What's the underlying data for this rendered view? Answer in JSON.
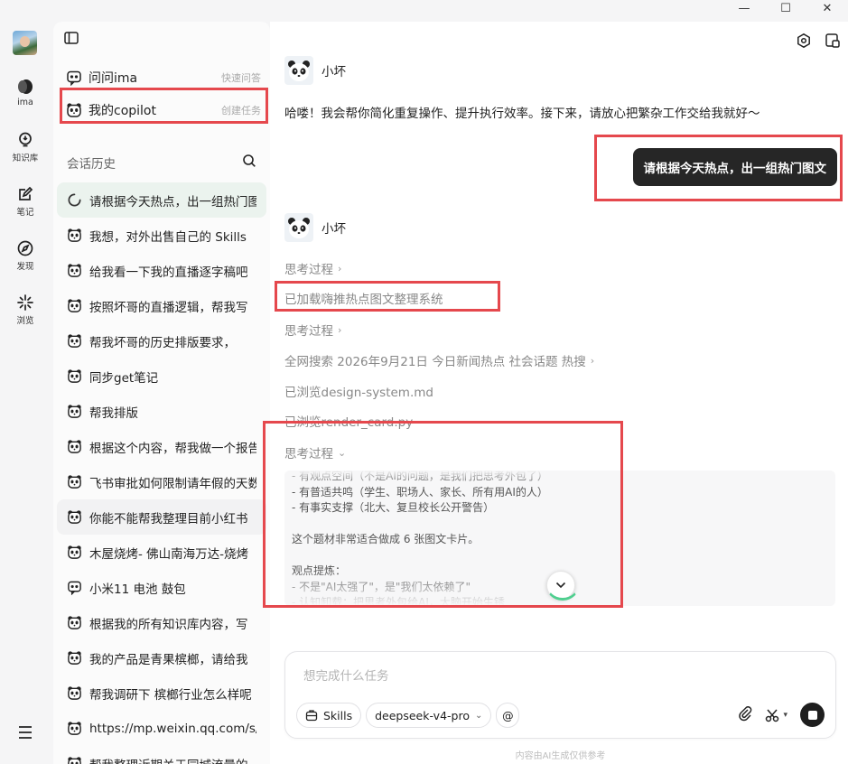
{
  "window": {
    "minimize": "—",
    "maximize": "☐",
    "close": "✕"
  },
  "rail": {
    "items": [
      {
        "label": "ima",
        "icon": "ima-logo-icon"
      },
      {
        "label": "知识库",
        "icon": "bulb-icon"
      },
      {
        "label": "笔记",
        "icon": "note-edit-icon"
      },
      {
        "label": "发现",
        "icon": "compass-icon"
      },
      {
        "label": "浏览",
        "icon": "sparkle-icon"
      }
    ]
  },
  "sidebar": {
    "quick": [
      {
        "label": "问问ima",
        "hint": "快速问答",
        "icon": "chat-bubble-icon"
      },
      {
        "label": "我的copilot",
        "hint": "创建任务",
        "icon": "panda-icon"
      }
    ],
    "history_title": "会话历史",
    "history": [
      {
        "text": "请根据今天热点，出一组热门图文",
        "icon": "loading-spinner-icon",
        "state": "active"
      },
      {
        "text": "我想，对外出售自己的 Skills",
        "icon": "panda-icon",
        "state": ""
      },
      {
        "text": "给我看一下我的直播逐字稿吧",
        "icon": "panda-icon",
        "state": ""
      },
      {
        "text": "按照坏哥的直播逻辑，帮我写",
        "icon": "panda-icon",
        "state": ""
      },
      {
        "text": "帮我坏哥的历史排版要求，",
        "icon": "panda-icon",
        "state": ""
      },
      {
        "text": "同步get笔记",
        "icon": "panda-icon",
        "state": ""
      },
      {
        "text": "帮我排版",
        "icon": "panda-icon",
        "state": ""
      },
      {
        "text": "根据这个内容，帮我做一个报告",
        "icon": "panda-icon",
        "state": ""
      },
      {
        "text": "飞书审批如何限制请年假的天数",
        "icon": "panda-icon",
        "state": ""
      },
      {
        "text": "你能不能帮我整理目前小红书",
        "icon": "panda-icon",
        "state": "hover"
      },
      {
        "text": "木屋烧烤- 佛山南海万达-烧烤",
        "icon": "panda-icon",
        "state": ""
      },
      {
        "text": "小米11 电池 鼓包",
        "icon": "chat-bubble-icon",
        "state": ""
      },
      {
        "text": "根据我的所有知识库内容，写",
        "icon": "panda-icon",
        "state": ""
      },
      {
        "text": "我的产品是青果槟榔，请给我",
        "icon": "panda-icon",
        "state": ""
      },
      {
        "text": "帮我调研下 槟榔行业怎么样呢",
        "icon": "panda-icon",
        "state": ""
      },
      {
        "text": "https://mp.weixin.qq.com/s/",
        "icon": "panda-icon",
        "state": ""
      },
      {
        "text": "帮我整理近期关于同城流量的",
        "icon": "panda-icon",
        "state": ""
      }
    ]
  },
  "chat": {
    "bot_name": "小坏",
    "greeting": "哈喽！我会帮你简化重复操作、提升执行效率。接下来，请放心把繁杂工作交给我就好～",
    "user_message": "请根据今天热点，出一组热门图文",
    "steps": {
      "think1": "思考过程",
      "loaded": "已加载嗨推热点图文整理系统",
      "think2": "思考过程",
      "search": "全网搜索 2026年9月21日 今日新闻热点 社会话题 热搜",
      "browse1": "已浏览design-system.md",
      "browse2": "已浏览render_card.py",
      "think3": "思考过程"
    },
    "thinking_text": "- 有观点空间（不是AI的问题，是我们把思考外包了）\n- 有普适共鸣（学生、职场人、家长、所有用AI的人）\n- 有事实支撑（北大、复旦校长公开警告）\n\n这个题材非常适合做成 6 张图文卡片。\n\n观点提炼：\n- 不是\"AI太强了\"，是\"我们太依赖了\"\n- 认知卸载：把思考外包给AI，大脑开始生锈"
  },
  "composer": {
    "placeholder": "想完成什么任务",
    "skills_label": "Skills",
    "model_label": "deepseek-v4-pro",
    "mention_label": "@",
    "footnote": "内容由AI生成仅供参考"
  },
  "colors": {
    "accent_green": "#4fcf8f",
    "annotation_red": "#e5484d",
    "bubble_dark": "#262626"
  }
}
